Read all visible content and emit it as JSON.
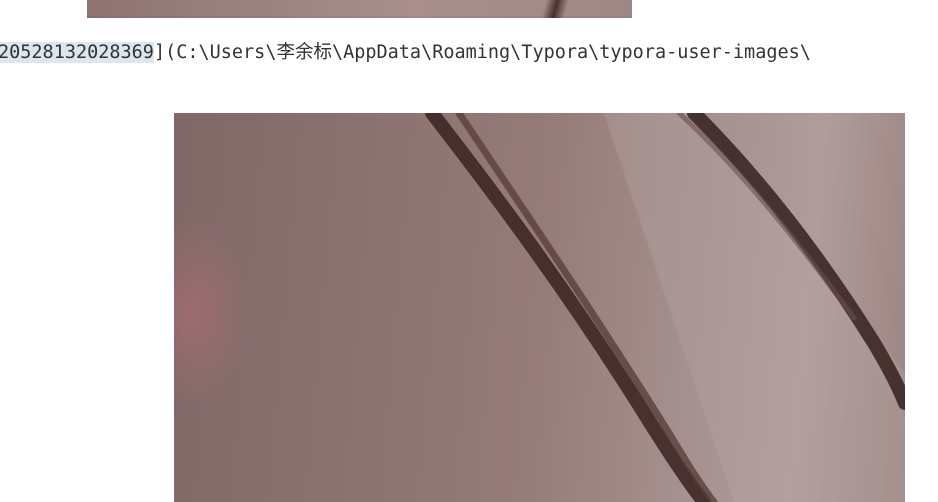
{
  "document": {
    "image_link": {
      "highlighted_text": "20528132028369",
      "remaining_text": "](C:\\Users\\李余标\\AppData\\Roaming\\Typora\\typora-user-images\\"
    }
  },
  "images": {
    "top_image": {
      "description_icon": "photo-icon"
    },
    "main_image": {
      "description_icon": "photo-icon"
    }
  },
  "colors": {
    "background": "#ffffff",
    "text": "#333333",
    "selection_highlight": "#dbe6ef"
  }
}
